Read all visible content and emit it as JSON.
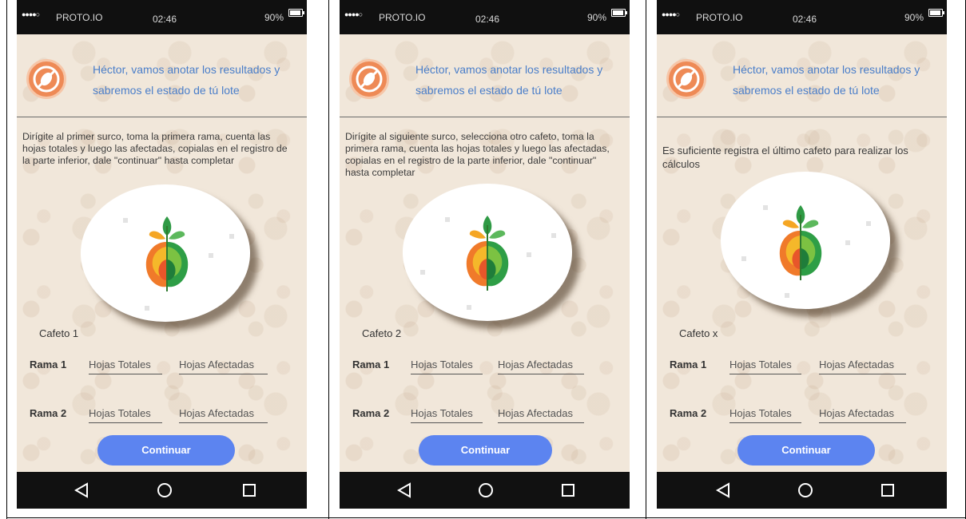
{
  "status": {
    "carrier": "PROTO.IO",
    "time": "02:46",
    "battery": "90%"
  },
  "header": {
    "message": "Héctor, vamos anotar los resultados y sabremos el estado de tú lote"
  },
  "screens": [
    {
      "instructions": "Dirígite al primer surco, toma la primera rama, cuenta las hojas totales y luego las afectadas, copialas en el registro de la parte inferior,  dale \"continuar\" hasta completar",
      "cafeto": "Cafeto 1"
    },
    {
      "instructions": "Dirígite al siguiente surco, selecciona otro cafeto, toma la primera rama, cuenta las hojas totales y luego las afectadas, copialas en el registro de la parte inferior,  dale \"continuar\" hasta completar",
      "cafeto": "Cafeto 2"
    },
    {
      "instructions": "Es suficiente registra el último cafeto para realizar los cálculos",
      "cafeto": "Cafeto x"
    }
  ],
  "form": {
    "rama1": "Rama 1",
    "rama2": "Rama 2",
    "hojas_totales": "Hojas Totales",
    "hojas_afectadas": "Hojas Afectadas",
    "continue": "Continuar"
  },
  "colors": {
    "accent": "#5c84f0",
    "header_text": "#4a7ec9",
    "logo": "#ee8a56",
    "background": "#f1e7da"
  },
  "icons": [
    "back-icon",
    "home-icon",
    "recents-icon",
    "no-pest-icon",
    "tree-brain-icon"
  ]
}
